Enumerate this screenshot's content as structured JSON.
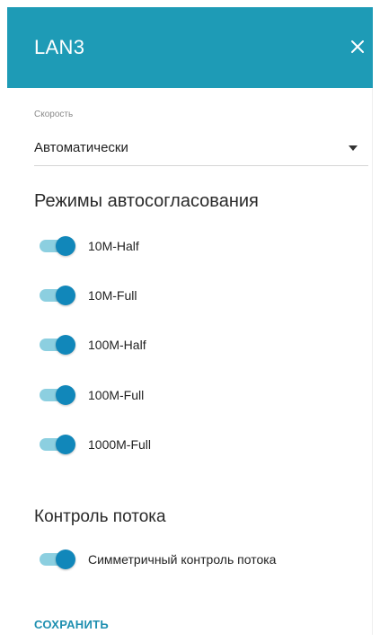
{
  "header": {
    "title": "LAN3",
    "background_color": "#1e9bb6",
    "close_icon": "close-icon"
  },
  "speed": {
    "label": "Скорость",
    "value": "Автоматически",
    "arrow_icon": "dropdown-arrow-icon"
  },
  "autoneg": {
    "title": "Режимы автосогласования",
    "items": [
      {
        "label": "10M-Half",
        "enabled": true
      },
      {
        "label": "10M-Full",
        "enabled": true
      },
      {
        "label": "100M-Half",
        "enabled": true
      },
      {
        "label": "100M-Full",
        "enabled": true
      },
      {
        "label": "1000M-Full",
        "enabled": true
      }
    ]
  },
  "flow_control": {
    "title": "Контроль потока",
    "items": [
      {
        "label": "Симметричный контроль потока",
        "enabled": true
      }
    ]
  },
  "footer": {
    "save_label": "СОХРАНИТЬ"
  },
  "colors": {
    "accent": "#1187ba",
    "toggle_track": "#8ccfe0",
    "link": "#1e8fb0"
  }
}
